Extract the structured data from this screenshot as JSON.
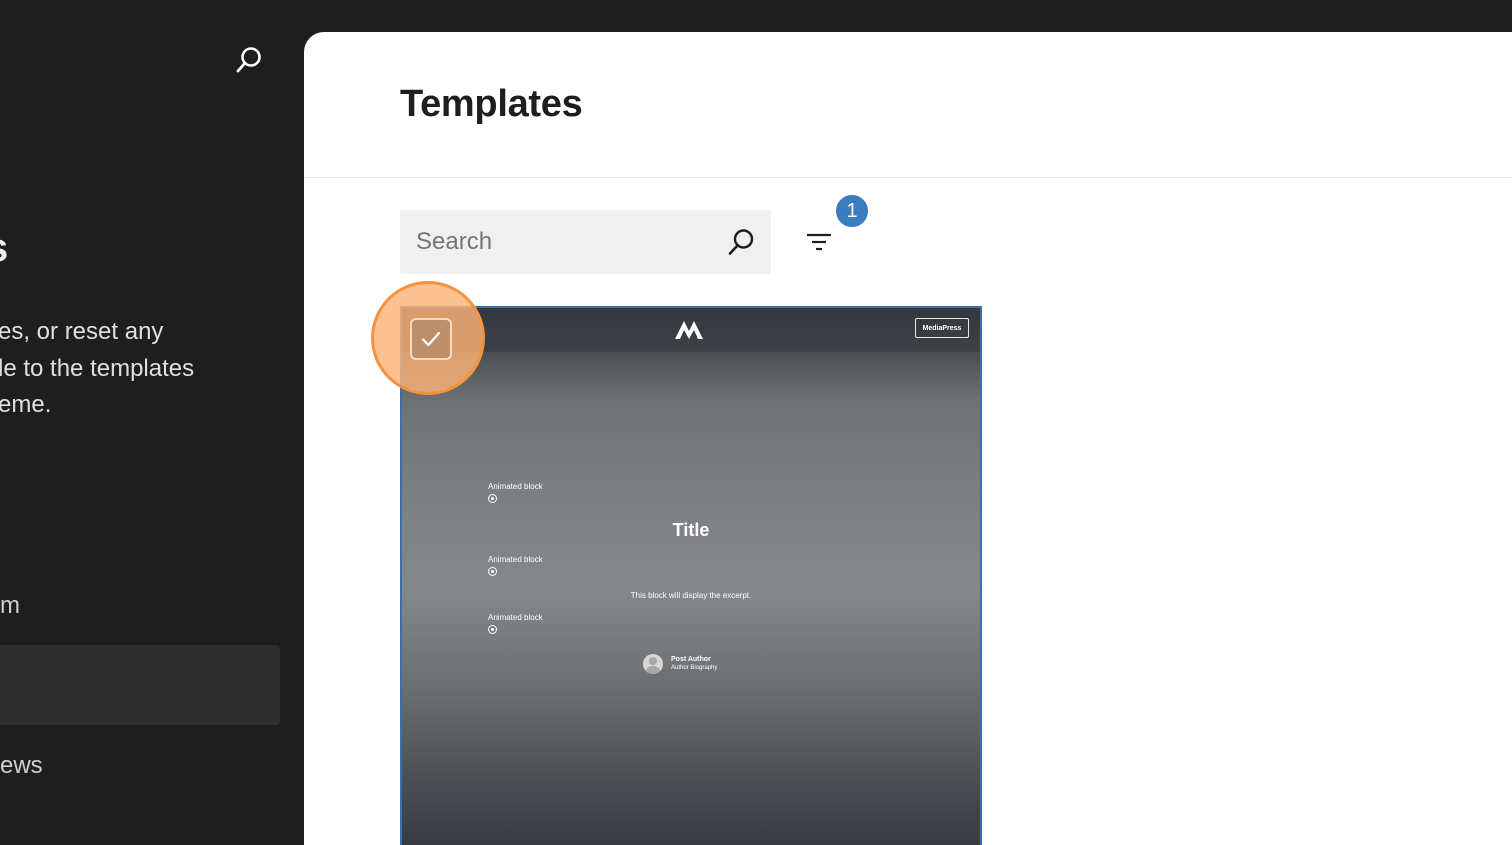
{
  "sidebar": {
    "heading_fragment": "s",
    "description_lines": [
      "es, or reset any",
      "le to the templates",
      "eme."
    ],
    "items": [
      {
        "label": "m"
      },
      {
        "label": ""
      },
      {
        "label": "ews"
      }
    ]
  },
  "main": {
    "title": "Templates",
    "search": {
      "placeholder": "Search",
      "value": ""
    },
    "filter": {
      "badge_count": "1"
    }
  },
  "template_card": {
    "selected": true,
    "preview": {
      "brand_button": "MediaPress",
      "animated_blocks": [
        "Animated block",
        "Animated block",
        "Animated block"
      ],
      "title": "Title",
      "excerpt": "This block will display the excerpt.",
      "author_name": "Post Author",
      "author_bio": "Author Biography"
    }
  },
  "colors": {
    "sidebar_bg": "#1e1e1e",
    "accent_blue": "#3a7cc0",
    "highlight_orange": "#f5923e"
  }
}
